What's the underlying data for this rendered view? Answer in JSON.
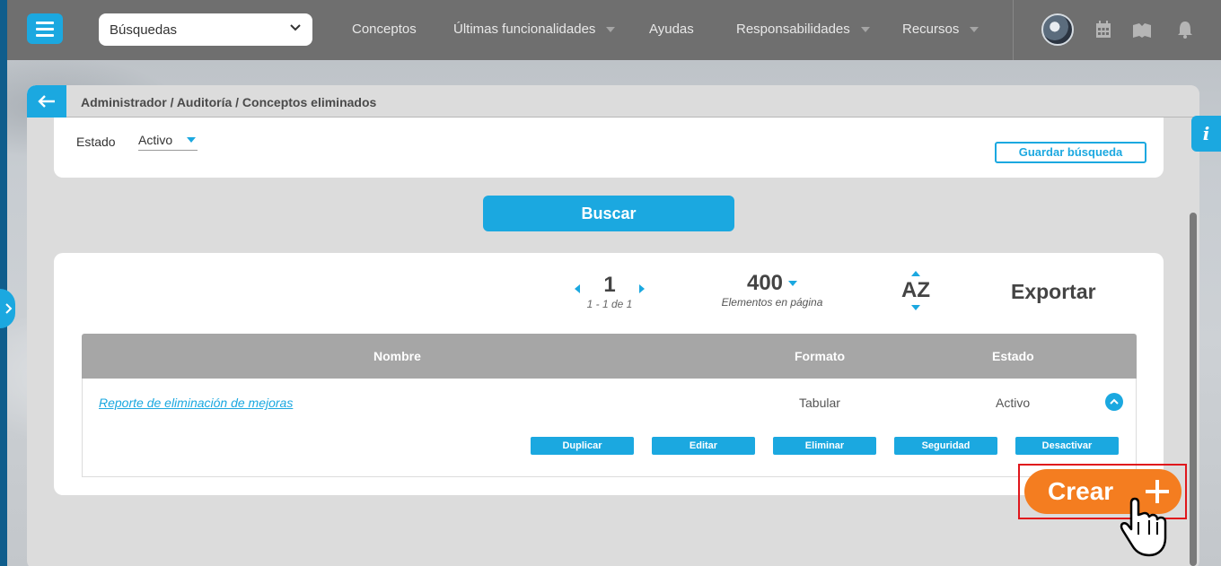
{
  "topbar": {
    "search_select": "Búsquedas",
    "nav": [
      {
        "label": "Conceptos"
      },
      {
        "label": "Últimas funcionalidades"
      },
      {
        "label": "Ayudas"
      },
      {
        "label": "Responsabilidades"
      },
      {
        "label": "Recursos"
      }
    ],
    "icons": [
      "calendar-icon",
      "book-icon",
      "bell-icon"
    ]
  },
  "breadcrumb": "Administrador / Auditoría / Conceptos eliminados",
  "filter": {
    "estado_label": "Estado",
    "estado_value": "Activo",
    "save_search_label": "Guardar búsqueda"
  },
  "buscar_label": "Buscar",
  "results": {
    "page_number": "1",
    "page_range": "1 - 1 de 1",
    "per_page": "400",
    "per_page_label": "Elementos en página",
    "sort_label": "AZ",
    "export_label": "Exportar",
    "columns": [
      "Nombre",
      "Formato",
      "Estado"
    ],
    "rows": [
      {
        "nombre": "Reporte de eliminación de mejoras",
        "formato": "Tabular",
        "estado": "Activo"
      }
    ],
    "actions": [
      "Duplicar",
      "Editar",
      "Eliminar",
      "Seguridad",
      "Desactivar"
    ]
  },
  "info_label": "i",
  "crear_label": "Crear",
  "colors": {
    "accent": "#1ba8e0",
    "crear": "#f47d20",
    "highlight": "#e0161c",
    "topbar": "#6f6f6f"
  }
}
